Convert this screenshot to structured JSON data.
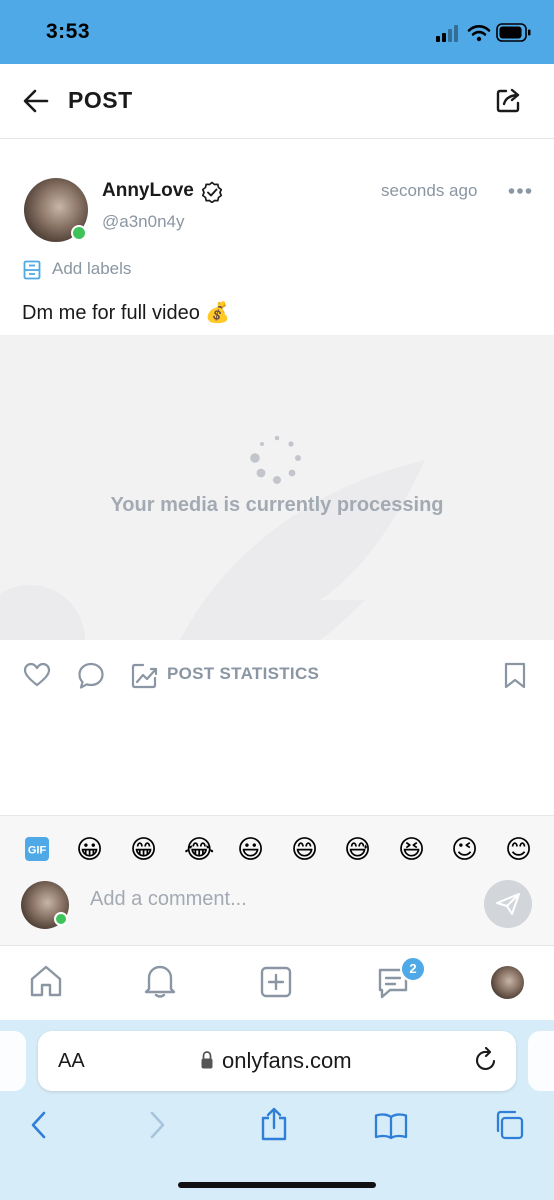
{
  "status_bar": {
    "time": "3:53"
  },
  "header": {
    "title": "POST"
  },
  "post": {
    "author_name": "AnnyLove",
    "author_handle": "@a3n0n4y",
    "timestamp": "seconds ago",
    "add_labels": "Add labels",
    "text": "Dm me for full video 💰",
    "media_status": "Your media is currently processing",
    "statistics_label": "POST STATISTICS"
  },
  "comment": {
    "emojis": [
      "😀",
      "😁",
      "😂",
      "😃",
      "😄",
      "😅",
      "😆",
      "😉",
      "😊"
    ],
    "placeholder": "Add a comment..."
  },
  "bottom_nav": {
    "messages_badge": "2"
  },
  "browser": {
    "aa_label": "AA",
    "url": "onlyfans.com"
  },
  "colors": {
    "accent": "#4fa9e6",
    "muted": "#8a96a3",
    "online": "#3ec25a"
  }
}
